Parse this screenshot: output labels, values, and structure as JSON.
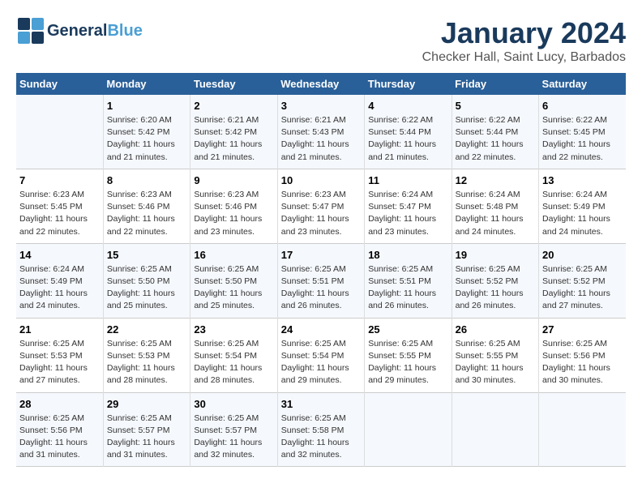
{
  "logo": {
    "part1": "General",
    "part2": "Blue"
  },
  "title": "January 2024",
  "subtitle": "Checker Hall, Saint Lucy, Barbados",
  "days_of_week": [
    "Sunday",
    "Monday",
    "Tuesday",
    "Wednesday",
    "Thursday",
    "Friday",
    "Saturday"
  ],
  "weeks": [
    [
      {
        "day": "",
        "info": ""
      },
      {
        "day": "1",
        "info": "Sunrise: 6:20 AM\nSunset: 5:42 PM\nDaylight: 11 hours\nand 21 minutes."
      },
      {
        "day": "2",
        "info": "Sunrise: 6:21 AM\nSunset: 5:42 PM\nDaylight: 11 hours\nand 21 minutes."
      },
      {
        "day": "3",
        "info": "Sunrise: 6:21 AM\nSunset: 5:43 PM\nDaylight: 11 hours\nand 21 minutes."
      },
      {
        "day": "4",
        "info": "Sunrise: 6:22 AM\nSunset: 5:44 PM\nDaylight: 11 hours\nand 21 minutes."
      },
      {
        "day": "5",
        "info": "Sunrise: 6:22 AM\nSunset: 5:44 PM\nDaylight: 11 hours\nand 22 minutes."
      },
      {
        "day": "6",
        "info": "Sunrise: 6:22 AM\nSunset: 5:45 PM\nDaylight: 11 hours\nand 22 minutes."
      }
    ],
    [
      {
        "day": "7",
        "info": "Sunrise: 6:23 AM\nSunset: 5:45 PM\nDaylight: 11 hours\nand 22 minutes."
      },
      {
        "day": "8",
        "info": "Sunrise: 6:23 AM\nSunset: 5:46 PM\nDaylight: 11 hours\nand 22 minutes."
      },
      {
        "day": "9",
        "info": "Sunrise: 6:23 AM\nSunset: 5:46 PM\nDaylight: 11 hours\nand 23 minutes."
      },
      {
        "day": "10",
        "info": "Sunrise: 6:23 AM\nSunset: 5:47 PM\nDaylight: 11 hours\nand 23 minutes."
      },
      {
        "day": "11",
        "info": "Sunrise: 6:24 AM\nSunset: 5:47 PM\nDaylight: 11 hours\nand 23 minutes."
      },
      {
        "day": "12",
        "info": "Sunrise: 6:24 AM\nSunset: 5:48 PM\nDaylight: 11 hours\nand 24 minutes."
      },
      {
        "day": "13",
        "info": "Sunrise: 6:24 AM\nSunset: 5:49 PM\nDaylight: 11 hours\nand 24 minutes."
      }
    ],
    [
      {
        "day": "14",
        "info": "Sunrise: 6:24 AM\nSunset: 5:49 PM\nDaylight: 11 hours\nand 24 minutes."
      },
      {
        "day": "15",
        "info": "Sunrise: 6:25 AM\nSunset: 5:50 PM\nDaylight: 11 hours\nand 25 minutes."
      },
      {
        "day": "16",
        "info": "Sunrise: 6:25 AM\nSunset: 5:50 PM\nDaylight: 11 hours\nand 25 minutes."
      },
      {
        "day": "17",
        "info": "Sunrise: 6:25 AM\nSunset: 5:51 PM\nDaylight: 11 hours\nand 26 minutes."
      },
      {
        "day": "18",
        "info": "Sunrise: 6:25 AM\nSunset: 5:51 PM\nDaylight: 11 hours\nand 26 minutes."
      },
      {
        "day": "19",
        "info": "Sunrise: 6:25 AM\nSunset: 5:52 PM\nDaylight: 11 hours\nand 26 minutes."
      },
      {
        "day": "20",
        "info": "Sunrise: 6:25 AM\nSunset: 5:52 PM\nDaylight: 11 hours\nand 27 minutes."
      }
    ],
    [
      {
        "day": "21",
        "info": "Sunrise: 6:25 AM\nSunset: 5:53 PM\nDaylight: 11 hours\nand 27 minutes."
      },
      {
        "day": "22",
        "info": "Sunrise: 6:25 AM\nSunset: 5:53 PM\nDaylight: 11 hours\nand 28 minutes."
      },
      {
        "day": "23",
        "info": "Sunrise: 6:25 AM\nSunset: 5:54 PM\nDaylight: 11 hours\nand 28 minutes."
      },
      {
        "day": "24",
        "info": "Sunrise: 6:25 AM\nSunset: 5:54 PM\nDaylight: 11 hours\nand 29 minutes."
      },
      {
        "day": "25",
        "info": "Sunrise: 6:25 AM\nSunset: 5:55 PM\nDaylight: 11 hours\nand 29 minutes."
      },
      {
        "day": "26",
        "info": "Sunrise: 6:25 AM\nSunset: 5:55 PM\nDaylight: 11 hours\nand 30 minutes."
      },
      {
        "day": "27",
        "info": "Sunrise: 6:25 AM\nSunset: 5:56 PM\nDaylight: 11 hours\nand 30 minutes."
      }
    ],
    [
      {
        "day": "28",
        "info": "Sunrise: 6:25 AM\nSunset: 5:56 PM\nDaylight: 11 hours\nand 31 minutes."
      },
      {
        "day": "29",
        "info": "Sunrise: 6:25 AM\nSunset: 5:57 PM\nDaylight: 11 hours\nand 31 minutes."
      },
      {
        "day": "30",
        "info": "Sunrise: 6:25 AM\nSunset: 5:57 PM\nDaylight: 11 hours\nand 32 minutes."
      },
      {
        "day": "31",
        "info": "Sunrise: 6:25 AM\nSunset: 5:58 PM\nDaylight: 11 hours\nand 32 minutes."
      },
      {
        "day": "",
        "info": ""
      },
      {
        "day": "",
        "info": ""
      },
      {
        "day": "",
        "info": ""
      }
    ]
  ]
}
